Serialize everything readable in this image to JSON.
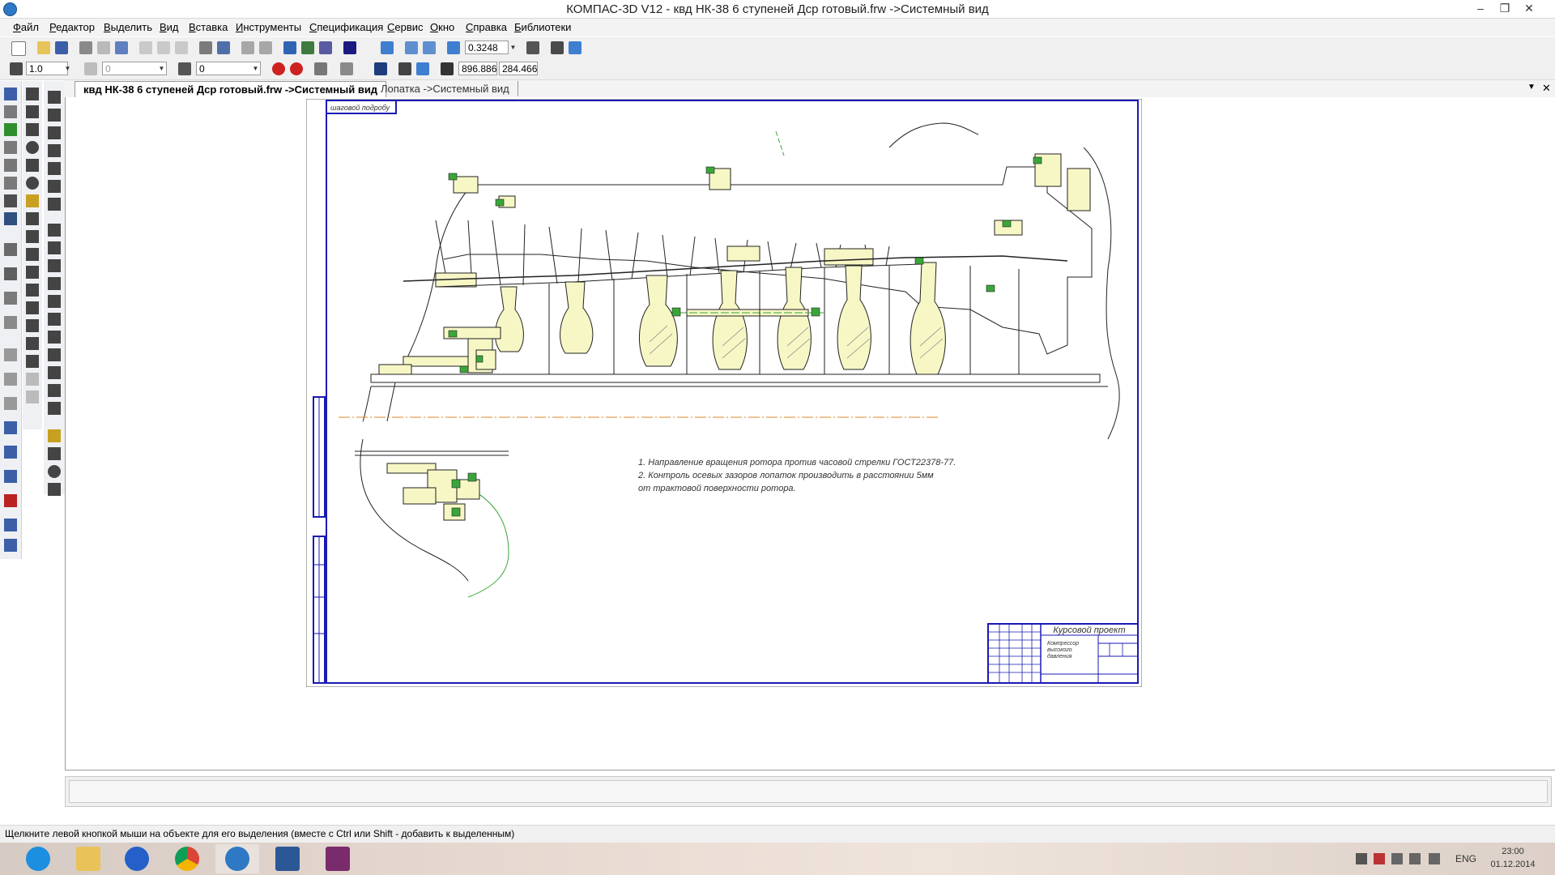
{
  "window": {
    "title": "КОМПАС-3D V12 - квд НК-38 6 ступеней Дср готовый.frw  ->Системный вид",
    "minimize_glyph": "–",
    "restore_glyph": "❐",
    "close_glyph": "✕"
  },
  "menu": {
    "items": [
      "Файл",
      "Редактор",
      "Выделить",
      "Вид",
      "Вставка",
      "Инструменты",
      "Спецификация",
      "Сервис",
      "Окно",
      "Справка",
      "Библиотеки"
    ]
  },
  "toolbar_main": {
    "zoom_value": "0.3248"
  },
  "toolbar_current": {
    "step_value": "1.0",
    "layer_value": "0",
    "style_value": "0",
    "x_coord": "896.886",
    "y_coord": "284.466"
  },
  "tabs": [
    {
      "label": "квд НК-38 6 ступеней Дср готовый.frw  ->Системный вид",
      "active": true
    },
    {
      "label": "Лопатка ->Системный вид",
      "active": false
    }
  ],
  "tab_controls": {
    "dropdown_glyph": "▼",
    "close_glyph": "✕"
  },
  "drawing": {
    "corner_label": "шаговой подробу",
    "notes": [
      "1. Направление вращения ротора против часовой стрелки  ГОСТ22378-77.",
      "2. Контроль осевых зазоров лопаток производить в расстоянии 5мм",
      "от трактовой поверхности ротора."
    ],
    "title_block": {
      "heading": "Курсовой проект",
      "name_line1": "Компрессор",
      "name_line2": "высокого",
      "name_line3": "давления"
    }
  },
  "status": {
    "hint": "Щелкните левой кнопкой мыши на объекте для его выделения (вместе с Ctrl или Shift - добавить к выделенным)"
  },
  "taskbar": {
    "apps": [
      "internet-explorer-icon",
      "file-explorer-icon",
      "lightning-app-icon",
      "chrome-icon",
      "kompas-icon",
      "word-icon",
      "winrar-icon"
    ],
    "lang": "ENG",
    "time": "23:00",
    "date": "01.12.2014"
  },
  "colors": {
    "sheet_frame": "#1a1ab4",
    "part_fill": "#f7f7c6",
    "axis_line": "#d98a2b",
    "accent_green": "#3aa63a"
  }
}
